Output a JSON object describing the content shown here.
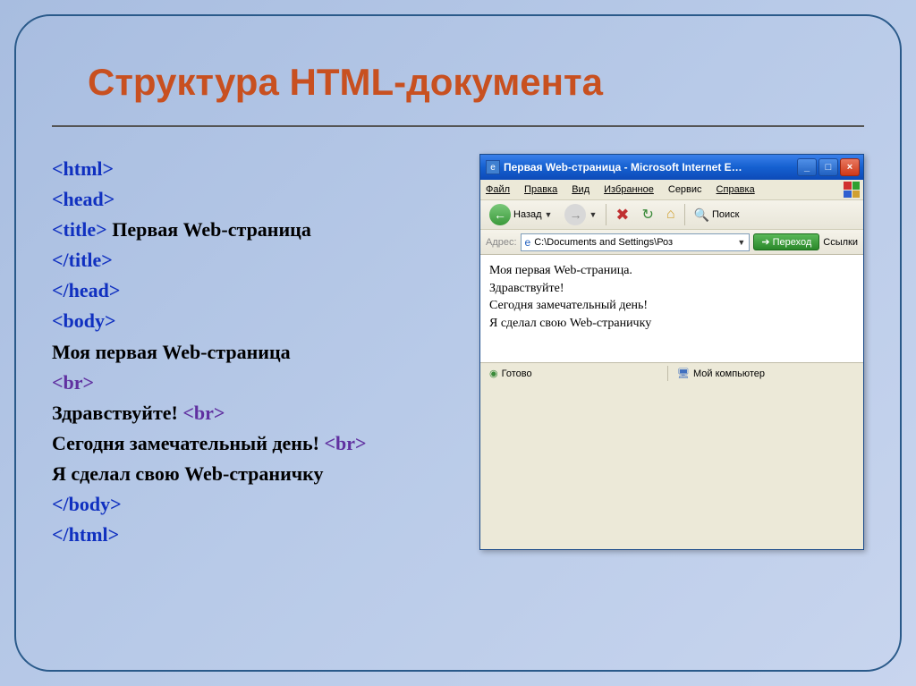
{
  "slide": {
    "title": "Структура HTML-документа"
  },
  "code": {
    "l1": "<html>",
    "l2": "<head>",
    "l3a": "<title>",
    "l3b": " Первая  Web-страница",
    "l4": "</title>",
    "l5": "</head>",
    "l6": "<body>",
    "l7": "Моя первая Web-страница",
    "l8": "<br>",
    "l9a": "Здравствуйте! ",
    "l9b": "<br>",
    "l10a": "Сегодня замечательный день! ",
    "l10b": "<br>",
    "l11": "Я сделал свою Web-страничку",
    "l12": "</body>",
    "l13": "</html>"
  },
  "browser": {
    "title": "Первая Web-страница - Microsoft Internet E…",
    "menu": {
      "file": "Файл",
      "edit": "Правка",
      "view": "Вид",
      "fav": "Избранное",
      "tools": "Сервис",
      "help": "Справка"
    },
    "toolbar": {
      "back": "Назад",
      "search": "Поиск"
    },
    "address": {
      "label": "Адрес:",
      "value": "C:\\Documents and Settings\\Роз",
      "go": "Переход",
      "links": "Ссылки"
    },
    "page": {
      "p1": "Моя первая Web-страница.",
      "p2": "Здравствуйте!",
      "p3": "Сегодня замечательный день!",
      "p4": "Я сделал свою Web-страничку"
    },
    "status": {
      "done": "Готово",
      "zone": "Мой компьютер"
    }
  }
}
